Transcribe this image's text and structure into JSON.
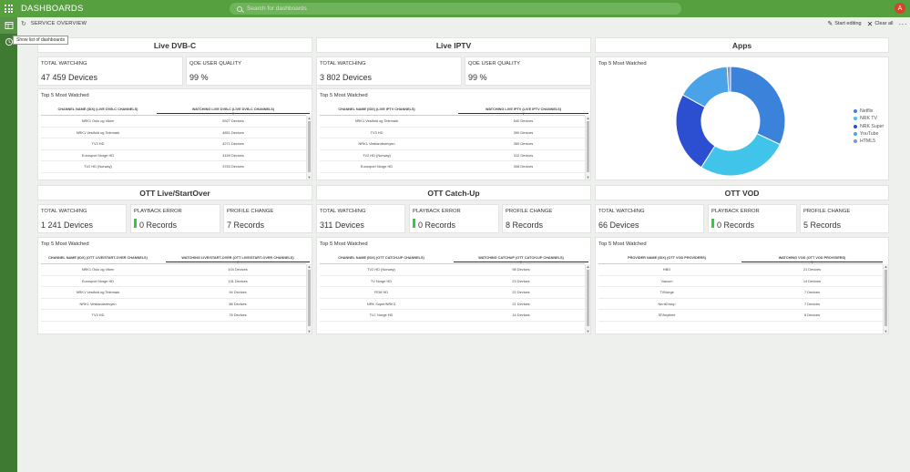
{
  "app": {
    "title": "DASHBOARDS",
    "search_placeholder": "Search for dashboards",
    "avatar_initial": "A",
    "tooltip": "Show list of dashboards"
  },
  "page": {
    "title": "SERVICE OVERVIEW",
    "start_editing": "Start editing",
    "clear_all": "Clear all",
    "more": "···"
  },
  "colors": {
    "brand": "#56a03f",
    "rail": "#3f7a33",
    "status_ok": "#2ecc40"
  },
  "dvbc": {
    "title": "Live DVB-C",
    "kpis": [
      {
        "label": "TOTAL WATCHING",
        "value": "47 459 Devices"
      },
      {
        "label": "QOE USER QUALITY",
        "value": "99 %"
      }
    ],
    "top": {
      "title": "Top 5 Most Watched",
      "columns": [
        "CHANNEL NAME (IDX) (LIVE DVB-C CHANNELS)",
        "WATCHING LIVE DVB-C (LIVE DVB-C CHANNELS)"
      ],
      "rows": [
        [
          "NRK1 Oslo og Viken",
          "5927 Devices"
        ],
        [
          "NRK1 Vestfold og Telemark",
          "4851 Devices"
        ],
        [
          "TV3 HD",
          "4271 Devices"
        ],
        [
          "Eurosport Norge HD",
          "4159 Devices"
        ],
        [
          "TV2 HD (Norway)",
          "3783 Devices"
        ]
      ]
    }
  },
  "iptv": {
    "title": "Live IPTV",
    "kpis": [
      {
        "label": "TOTAL WATCHING",
        "value": "3 802 Devices"
      },
      {
        "label": "QOE USER QUALITY",
        "value": "99 %"
      }
    ],
    "top": {
      "title": "Top 5 Most Watched",
      "columns": [
        "CHANNEL NAME (IDX) (LIVE IPTV CHANNELS)",
        "WATCHING LIVE IPTV (LIVE IPTV CHANNELS)"
      ],
      "rows": [
        [
          "NRK1 Vestfold og Telemark",
          "540 Devices"
        ],
        [
          "TV3 HD",
          "390 Devices"
        ],
        [
          "NRK1 Vestlandsrevyen",
          "360 Devices"
        ],
        [
          "TV2 HD (Norway)",
          "312 Devices"
        ],
        [
          "Eurosport Norge HD",
          "308 Devices"
        ]
      ]
    }
  },
  "apps": {
    "title": "Apps",
    "top_title": "Top 5 Most Watched",
    "chart_data": {
      "type": "pie",
      "categories": [
        "Netflix",
        "NRK TV",
        "NRK Super",
        "YouTube",
        "HTML5"
      ],
      "values": [
        32,
        27,
        24,
        16,
        1
      ],
      "colors": [
        "#3b82db",
        "#41c4ea",
        "#2c4ed1",
        "#4aa3e8",
        "#8b93b8"
      ],
      "legend_position": "right"
    }
  },
  "ott_live": {
    "title": "OTT Live/StartOver",
    "kpis": [
      {
        "label": "TOTAL WATCHING",
        "value": "1 241 Devices"
      },
      {
        "label": "PLAYBACK ERROR",
        "value": "0 Records"
      },
      {
        "label": "PROFILE CHANGE",
        "value": "7 Records"
      }
    ],
    "top": {
      "title": "Top 5 Most Watched",
      "columns": [
        "CHANNEL NAME (IDX) (OTT LIVE/START-OVER CHANNELS)",
        "WATCHING LIVE/START-OVER (OTT LIVE/START-OVER CHANNELS)"
      ],
      "rows": [
        [
          "NRK1 Oslo og Viken",
          "104 Devices"
        ],
        [
          "Eurosport Norge HD",
          "131 Devices"
        ],
        [
          "NRK1 Vestfold og Telemark",
          "94 Devices"
        ],
        [
          "NRK1 Vestlandsrevyen",
          "88 Devices"
        ],
        [
          "TV3 HD",
          "78 Devices"
        ]
      ]
    }
  },
  "ott_catchup": {
    "title": "OTT Catch-Up",
    "kpis": [
      {
        "label": "TOTAL WATCHING",
        "value": "311 Devices"
      },
      {
        "label": "PLAYBACK ERROR",
        "value": "0 Records"
      },
      {
        "label": "PROFILE CHANGE",
        "value": "8 Records"
      }
    ],
    "top": {
      "title": "Top 5 Most Watched",
      "columns": [
        "CHANNEL NAME (IDX) (OTT CATCH-UP CHANNELS)",
        "WATCHING CATCHUP (OTT CATCH-UP CHANNELS)"
      ],
      "rows": [
        [
          "TV2 HD (Norway)",
          "98 Devices"
        ],
        [
          "TV Norge HD",
          "23 Devices"
        ],
        [
          "FEM HD",
          "22 Devices"
        ],
        [
          "NRK Super/NRK3",
          "21 Devices"
        ],
        [
          "TLC Norge HD",
          "14 Devices"
        ]
      ]
    }
  },
  "ott_vod": {
    "title": "OTT VOD",
    "kpis": [
      {
        "label": "TOTAL WATCHING",
        "value": "66 Devices"
      },
      {
        "label": "PLAYBACK ERROR",
        "value": "0 Records"
      },
      {
        "label": "PROFILE CHANGE",
        "value": "5 Records"
      }
    ],
    "top": {
      "title": "Top 5 Most Watched",
      "columns": [
        "PROVIDER NAME (IDX) (OTT VOD PROVIDERS)",
        "WATCHING VOD (OTT VOD PROVIDERS)"
      ],
      "rows": [
        [
          "HBO",
          "21 Devices"
        ],
        [
          "Viacom",
          "14 Devices"
        ],
        [
          "TVNorge",
          "7 Devices"
        ],
        [
          "NentGroup",
          "7 Devices"
        ],
        [
          "SFAnytime",
          "6 Devices"
        ]
      ]
    }
  }
}
